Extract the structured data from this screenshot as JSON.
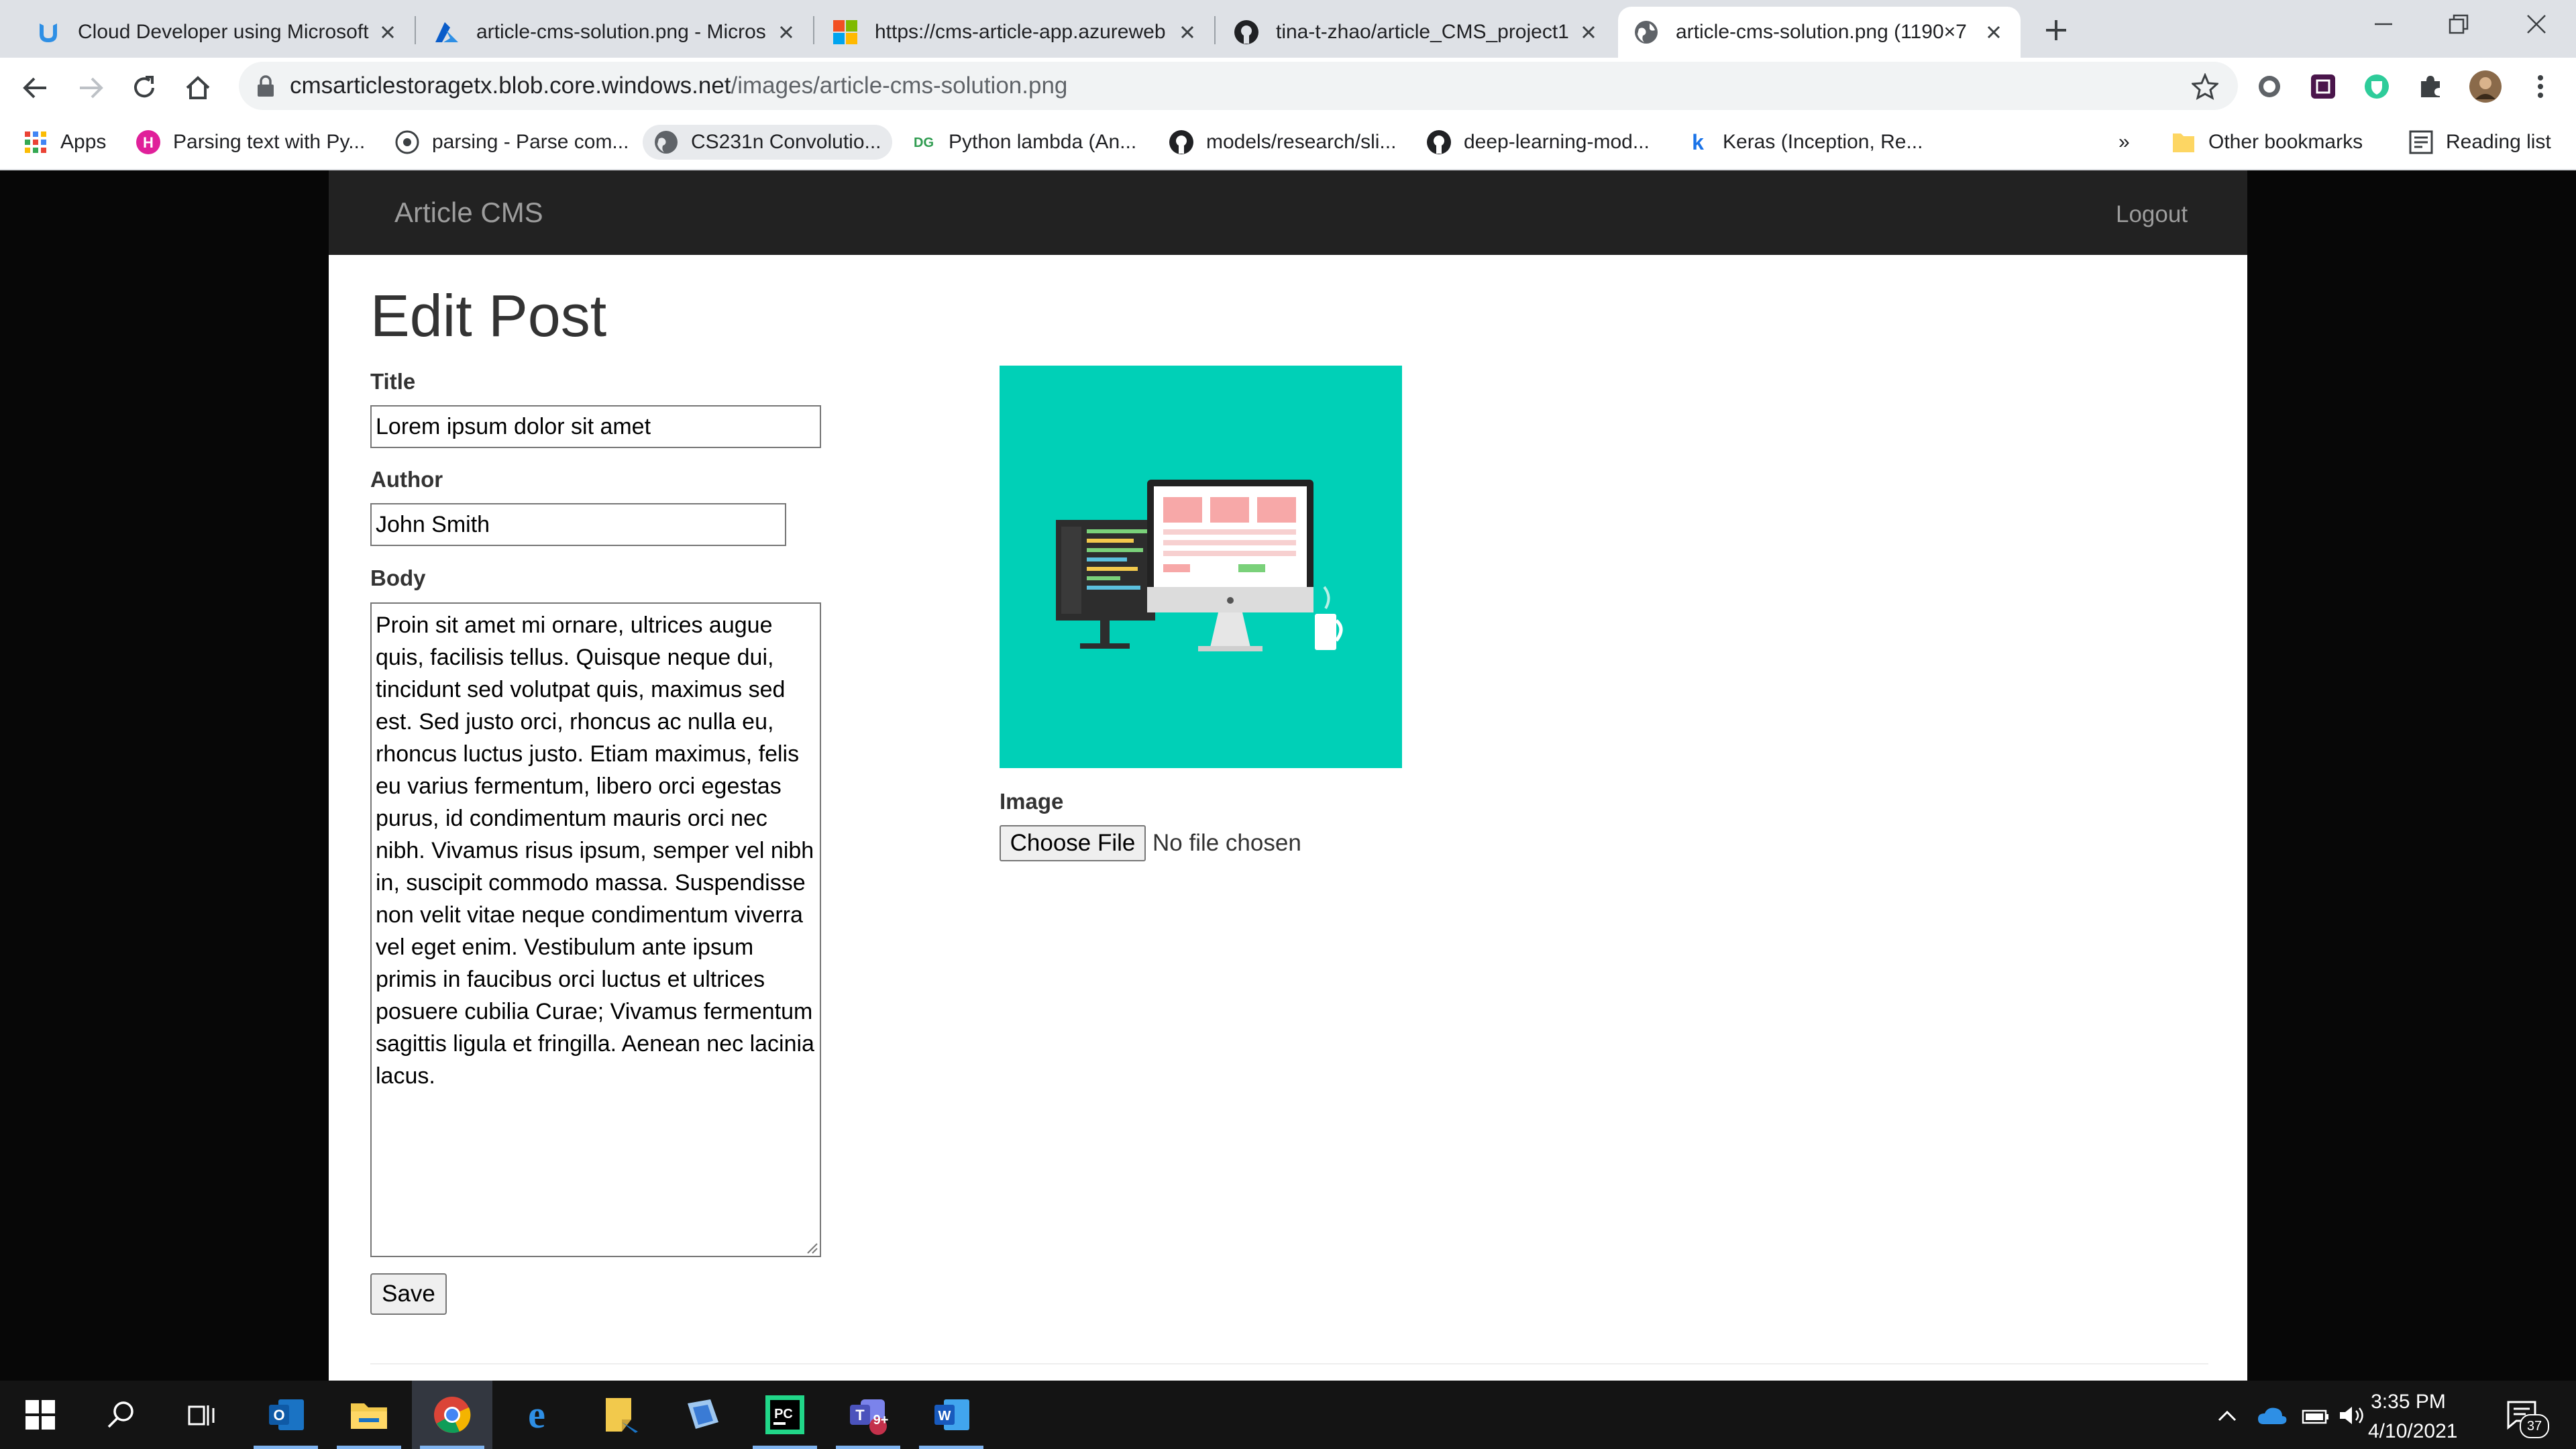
{
  "browser": {
    "tabs": [
      {
        "label": "Cloud Developer using Microsoft",
        "icon": "udacity-icon",
        "active": false
      },
      {
        "label": "article-cms-solution.png - Micros",
        "icon": "azure-icon",
        "active": false
      },
      {
        "label": "https://cms-article-app.azureweb",
        "icon": "microsoft-icon",
        "active": false
      },
      {
        "label": "tina-t-zhao/article_CMS_project1",
        "icon": "github-icon",
        "active": false
      },
      {
        "label": "article-cms-solution.png (1190×7",
        "icon": "globe-icon",
        "active": true
      }
    ],
    "url_host": "cmsarticlestoragetx.blob.core.windows.net",
    "url_path": "/images/article-cms-solution.png",
    "bookmarks": [
      {
        "label": "Apps",
        "icon": "apps-grid-icon"
      },
      {
        "label": "Parsing text with Py...",
        "icon": "hashnode-icon"
      },
      {
        "label": "parsing - Parse com...",
        "icon": "stackexchange-icon"
      },
      {
        "label": "CS231n Convolutio...",
        "icon": "globe-icon"
      },
      {
        "label": "Python lambda (An...",
        "icon": "dg-icon"
      },
      {
        "label": "models/research/sli...",
        "icon": "github-icon"
      },
      {
        "label": "deep-learning-mod...",
        "icon": "github-icon"
      },
      {
        "label": "Keras (Inception, Re...",
        "icon": "k-icon"
      }
    ],
    "overflow_label": "»",
    "other_bookmarks": "Other bookmarks",
    "reading_list": "Reading list"
  },
  "app": {
    "brand": "Article CMS",
    "logout": "Logout",
    "page_title": "Edit Post",
    "form": {
      "title_label": "Title",
      "title_value": "Lorem ipsum dolor sit amet",
      "author_label": "Author",
      "author_value": "John Smith",
      "body_label": "Body",
      "body_value": "Proin sit amet mi ornare, ultrices augue quis, facilisis tellus. Quisque neque dui, tincidunt sed volutpat quis, maximus sed est. Sed justo orci, rhoncus ac nulla eu, rhoncus luctus justo. Etiam maximus, felis eu varius fermentum, libero orci egestas purus, id condimentum mauris orci nec nibh. Vivamus risus ipsum, semper vel nibh in, suscipit commodo massa. Suspendisse non velit vitae neque condimentum viverra vel eget enim. Vestibulum ante ipsum primis in faucibus orci luctus et ultrices posuere cubilia Curae; Vivamus fermentum sagittis ligula et fringilla. Aenean nec lacinia lacus.",
      "image_label": "Image",
      "choose_file": "Choose File",
      "no_file": "No file chosen",
      "save": "Save"
    }
  },
  "taskbar": {
    "apps": [
      "start-icon",
      "search-icon",
      "task-view-icon",
      "outlook-icon",
      "file-explorer-icon",
      "chrome-icon",
      "edge-icon",
      "sticky-notes-icon",
      "paint-icon",
      "pycharm-icon",
      "teams-icon",
      "word-icon"
    ],
    "teams_badge": "9+",
    "time": "3:35 PM",
    "date": "4/10/2021",
    "notification_count": "37"
  },
  "colors": {
    "navbar": "#222222",
    "preview_bg": "#00d0b7",
    "tab_strip": "#dee1e6"
  }
}
